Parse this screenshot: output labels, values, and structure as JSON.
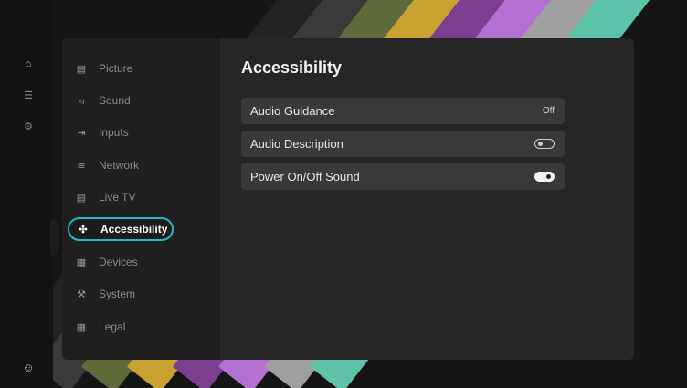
{
  "rail": {
    "home_icon": "home-icon",
    "list_icon": "list-icon",
    "settings_icon": "settings-icon",
    "assistant_icon": "assistant-icon"
  },
  "sidebar": {
    "items": [
      {
        "label": "Picture",
        "icon": "picture-icon"
      },
      {
        "label": "Sound",
        "icon": "speaker-icon"
      },
      {
        "label": "Inputs",
        "icon": "input-icon"
      },
      {
        "label": "Network",
        "icon": "wifi-icon"
      },
      {
        "label": "Live TV",
        "icon": "tv-guide-icon"
      },
      {
        "label": "Accessibility",
        "icon": "accessibility-icon",
        "active": true
      },
      {
        "label": "Devices",
        "icon": "devices-icon"
      },
      {
        "label": "System",
        "icon": "wrench-icon"
      },
      {
        "label": "Legal",
        "icon": "document-icon"
      }
    ]
  },
  "content": {
    "title": "Accessibility",
    "settings": [
      {
        "label": "Audio Guidance",
        "value": "Off"
      },
      {
        "label": "Audio Description",
        "toggle": "off"
      },
      {
        "label": "Power On/Off Sound",
        "toggle": "on"
      }
    ]
  },
  "colors": {
    "accent": "#27b5c9",
    "stripes": [
      "#2c2c2c",
      "#5a5a5a",
      "#6b7a3a",
      "#c7a030",
      "#7a4a8e",
      "#b36fd1",
      "#9c9c9c",
      "#5cc3a8"
    ]
  }
}
